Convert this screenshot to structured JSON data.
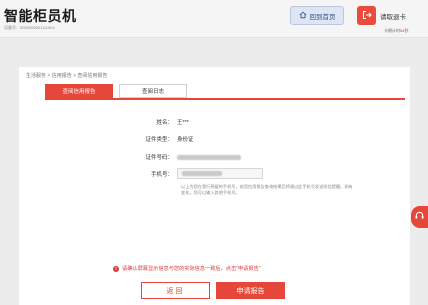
{
  "header": {
    "app_title": "智能柜员机",
    "device_number": "设备号：0000000001111004",
    "home_button": "回到首页",
    "exit_button": "请取退卡",
    "timeout_prefix": "卡倒计时",
    "timeout_value": "54",
    "timeout_suffix": "秒"
  },
  "breadcrumb": "生活服务 > 信用报告 > 查阅信用报告",
  "tabs": [
    {
      "label": "查阅信用报告",
      "active": true
    },
    {
      "label": "查阅日志",
      "active": false
    }
  ],
  "form": {
    "name_label": "姓名：",
    "name_value": "王***",
    "id_type_label": "证件类型：",
    "id_type_value": "身份证",
    "id_number_label": "证件号码：",
    "phone_label": "手机号：",
    "hint": "以上为您在我行预留的手机号，若您信用报告查询结果后将通过此手机号发送短信提醒。如有变化，您可以输入其他手机号。"
  },
  "warning": "请确认屏幕显示信息与您的实际信息一致后，点击\"申请报告\"",
  "buttons": {
    "back": "返回",
    "apply": "申请报告"
  },
  "colors": {
    "accent": "#e5483a",
    "home_button_bg": "#dfe6f3"
  },
  "icons": {
    "home": "home-icon",
    "exit": "exit-icon",
    "warning": "warning-icon",
    "support": "headset-icon"
  }
}
